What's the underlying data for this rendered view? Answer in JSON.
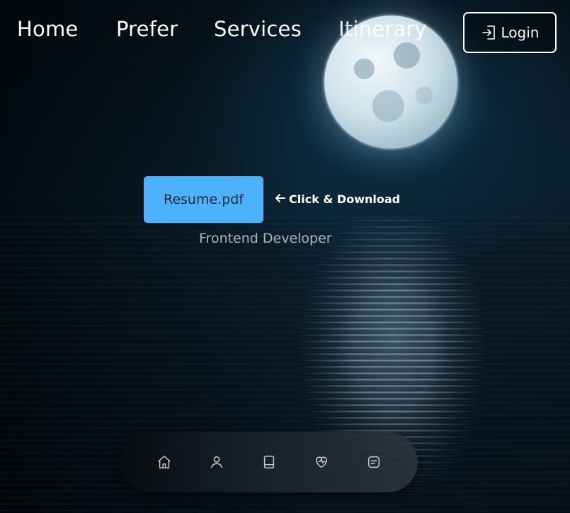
{
  "nav": {
    "links": [
      "Home",
      "Prefer",
      "Services",
      "Itinerary"
    ],
    "login_label": "Login"
  },
  "hero": {
    "resume_button": "Resume.pdf",
    "download_hint": "Click & Download",
    "subtitle": "Frontend Developer"
  },
  "dock": {
    "icons": [
      "home-icon",
      "user-icon",
      "book-icon",
      "heart-icon",
      "message-icon"
    ]
  },
  "colors": {
    "accent": "#4eb1fb",
    "text": "#ffffff",
    "subtitle": "#aeb4b9"
  }
}
